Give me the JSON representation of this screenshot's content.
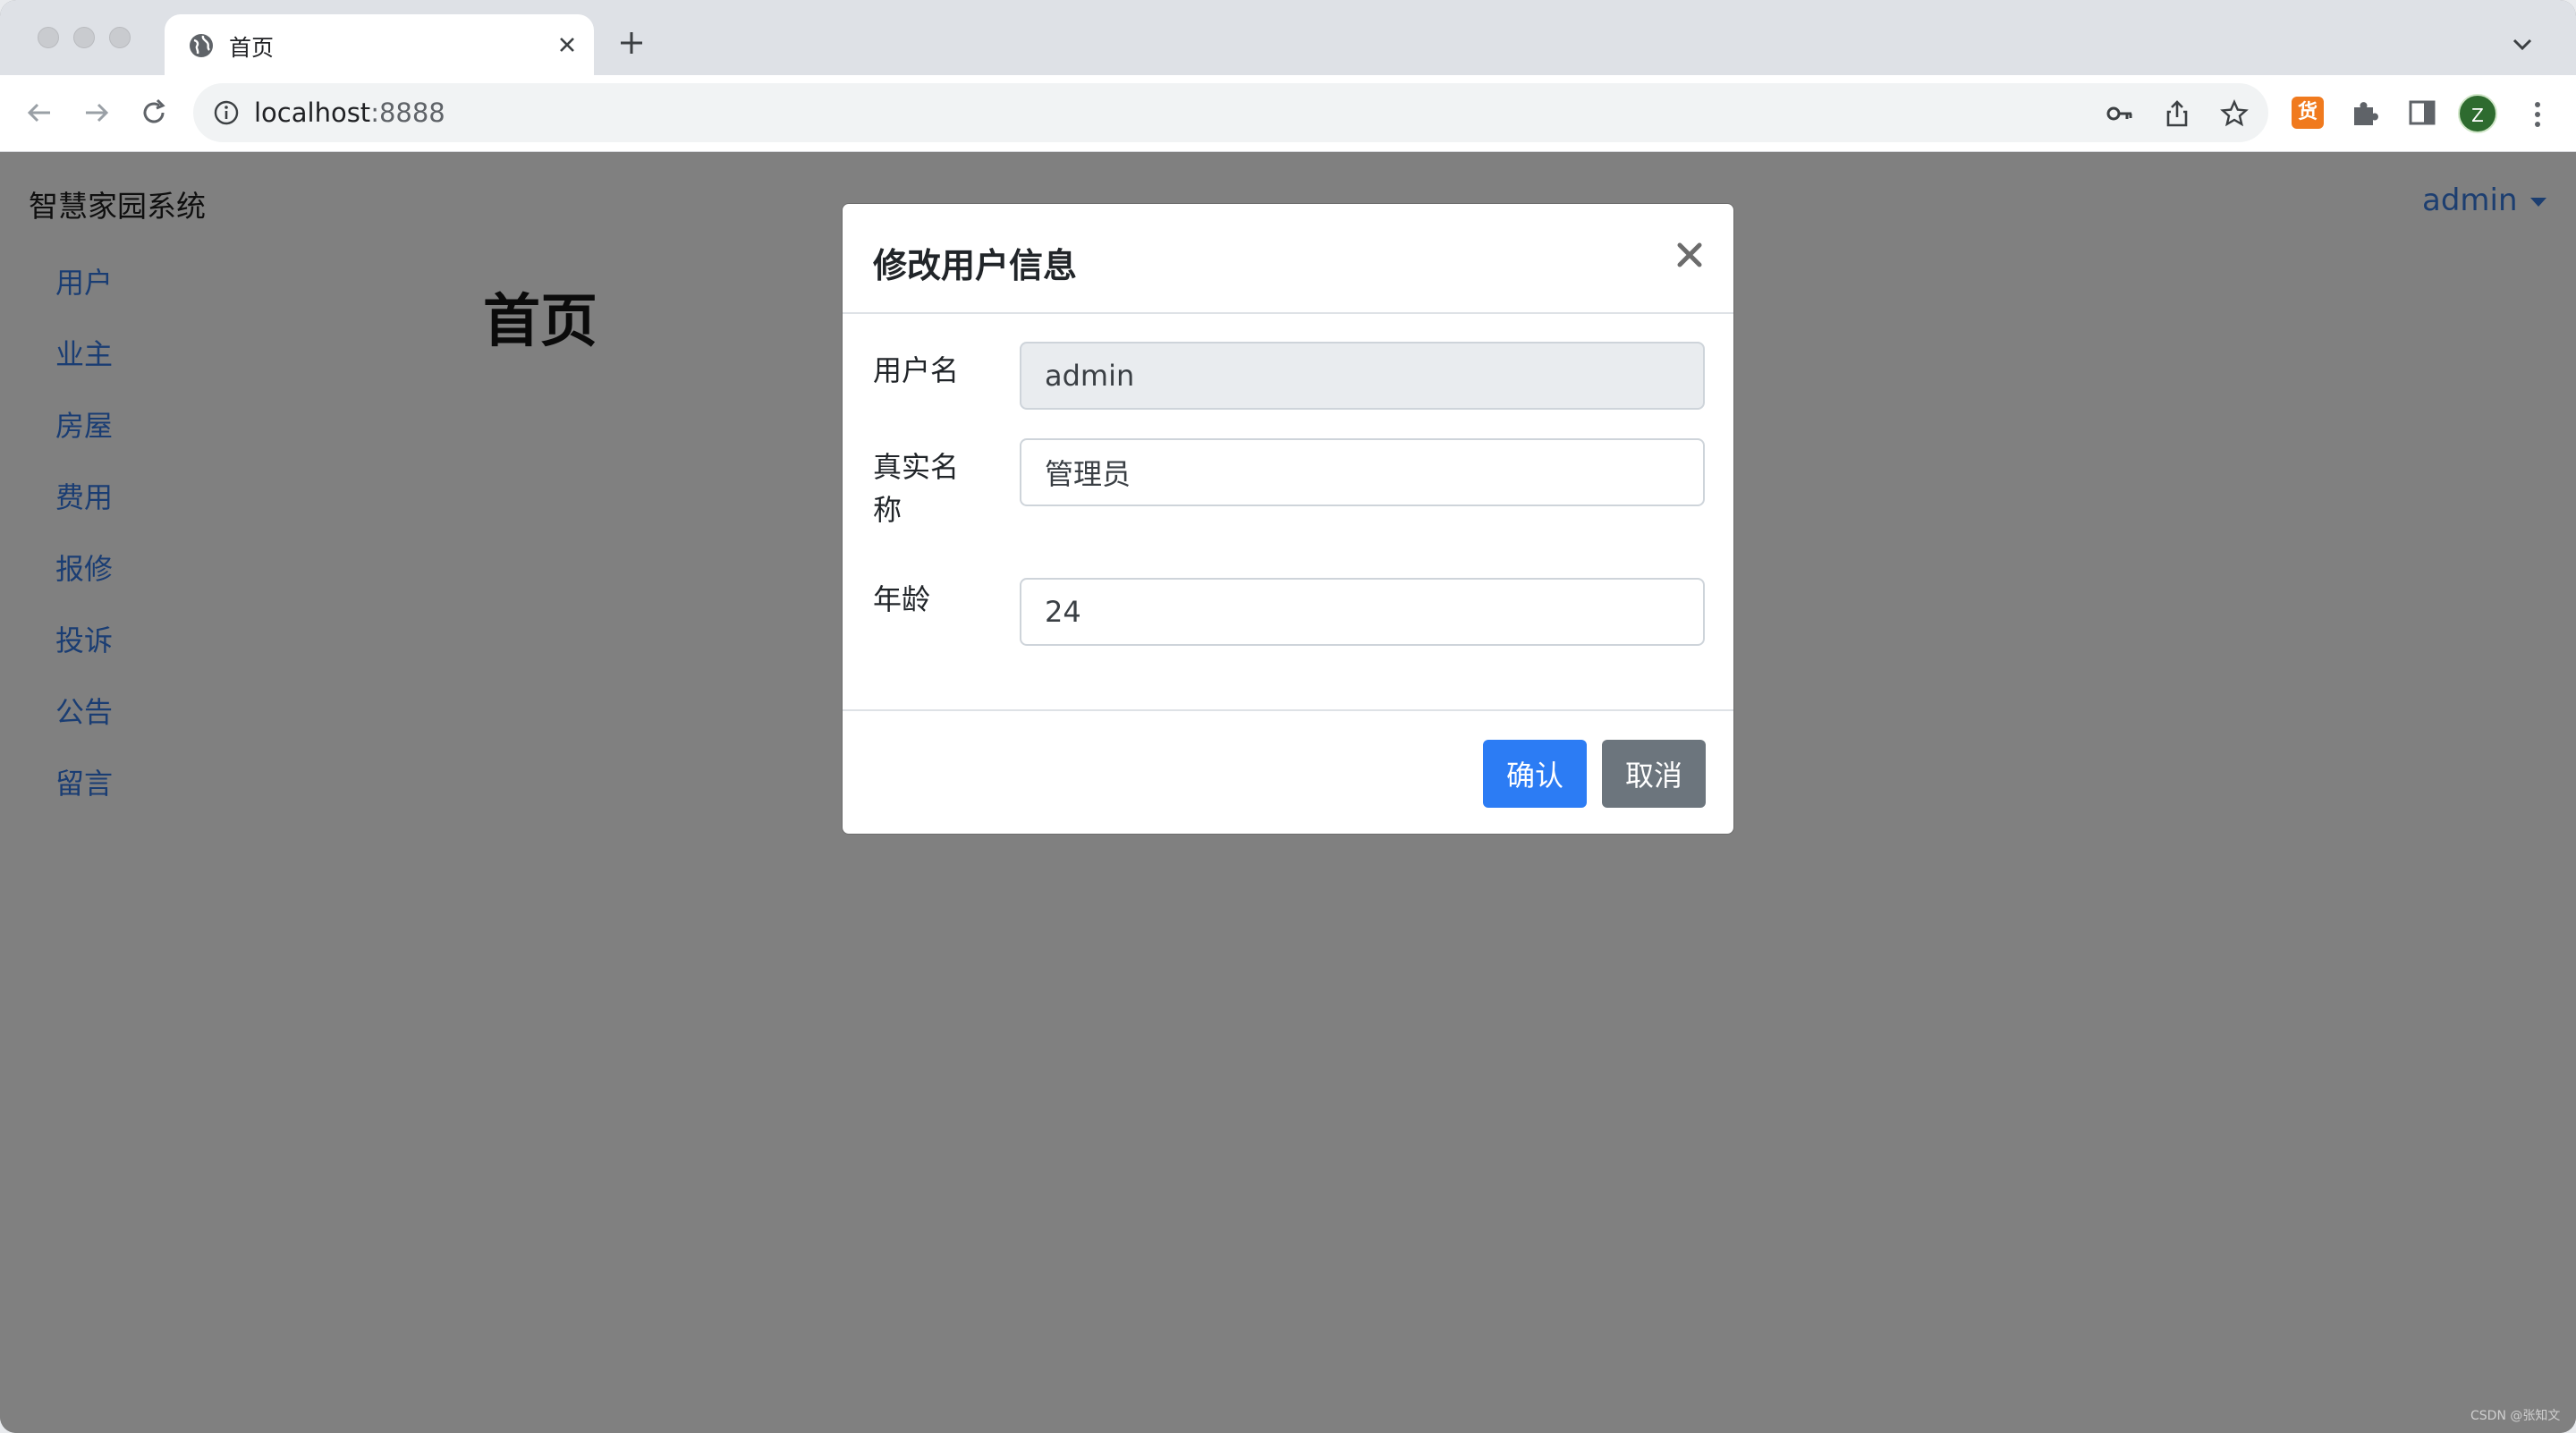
{
  "browser": {
    "tab_title": "首页",
    "url_host": "localhost",
    "url_port": ":8888",
    "extension_label": "货",
    "profile_initial": "Z",
    "colors": {
      "tabstrip": "#dee1e6",
      "toolbar": "#ffffff",
      "avatar": "#2e6b2f",
      "extension": "#f07a1e"
    }
  },
  "app": {
    "brand": "智慧家园系统",
    "user_menu": "admin",
    "page_title": "首页",
    "sidebar": {
      "items": [
        {
          "label": "用户"
        },
        {
          "label": "业主"
        },
        {
          "label": "房屋"
        },
        {
          "label": "费用"
        },
        {
          "label": "报修"
        },
        {
          "label": "投诉"
        },
        {
          "label": "公告"
        },
        {
          "label": "留言"
        }
      ]
    },
    "colors": {
      "overlay": "#808080",
      "link": "#1a3d73"
    }
  },
  "modal": {
    "title": "修改用户信息",
    "fields": {
      "username": {
        "label": "用户名",
        "value": "admin"
      },
      "real_name": {
        "label_line1": "真实名",
        "label_line2": "称",
        "value": "管理员"
      },
      "age": {
        "label": "年龄",
        "value": "24"
      }
    },
    "confirm_label": "确认",
    "cancel_label": "取消",
    "colors": {
      "primary": "#2c7cf4",
      "secondary": "#6c757d",
      "readonly_bg": "#e9ecef"
    }
  },
  "watermark": "CSDN @张知文"
}
